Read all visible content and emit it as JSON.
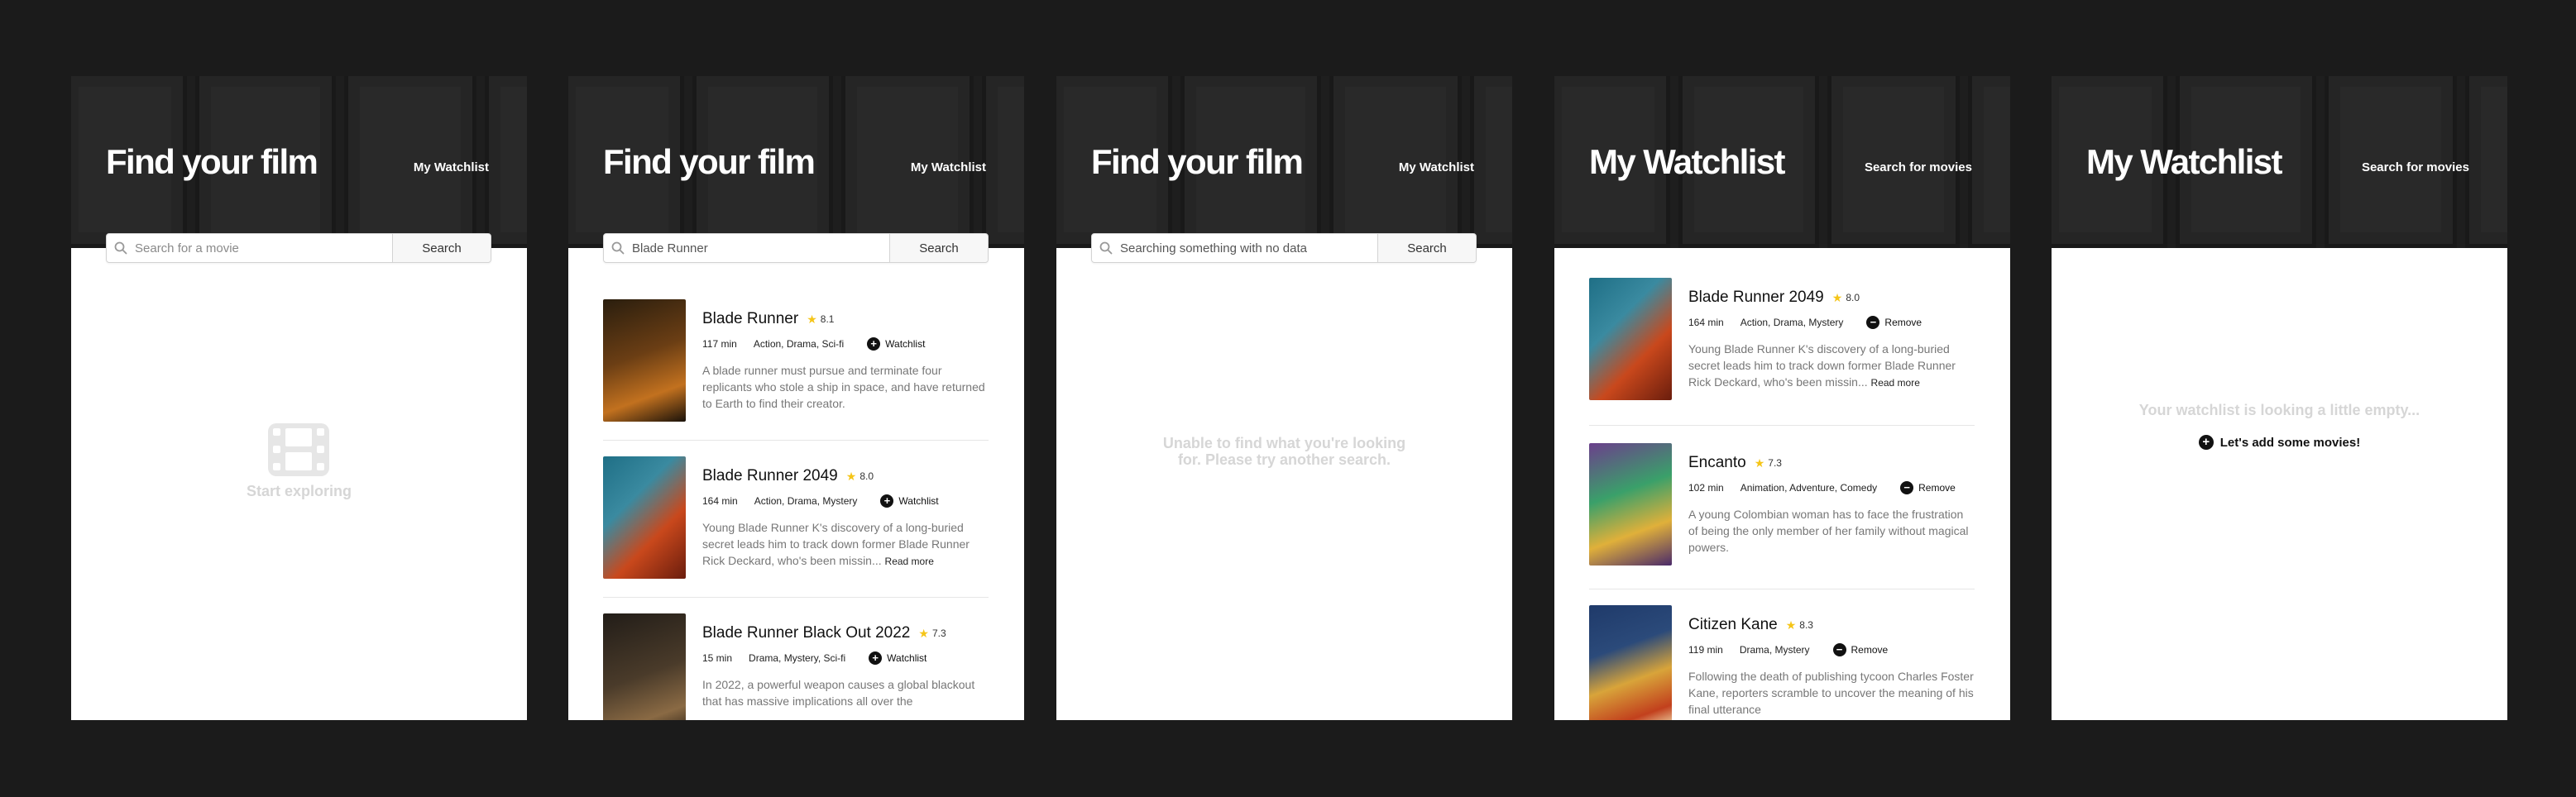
{
  "screens": [
    {
      "hero_title": "Find your film",
      "nav_link": "My Watchlist",
      "search": {
        "placeholder": "Search for a movie",
        "button": "Search"
      },
      "empty_text": "Start exploring",
      "empty_icon": "film-icon"
    },
    {
      "hero_title": "Find your film",
      "nav_link": "My Watchlist",
      "search": {
        "value": "Blade Runner",
        "button": "Search"
      },
      "results": [
        {
          "title": "Blade Runner",
          "rating": "8.1",
          "runtime": "117 min",
          "genres": "Action, Drama, Sci-fi",
          "action": "Watchlist",
          "description": "A blade runner must pursue and terminate four replicants who stole a ship in space, and have returned to Earth to find their creator.",
          "poster_colors": [
            "#3a2a12",
            "#b0611d"
          ]
        },
        {
          "title": "Blade Runner 2049",
          "rating": "8.0",
          "runtime": "164 min",
          "genres": "Action, Drama, Mystery",
          "action": "Watchlist",
          "description": "Young Blade Runner K's discovery of a long-buried secret leads him to track down former Blade Runner Rick Deckard, who's been missin...",
          "read_more": "Read more",
          "poster_colors": [
            "#1f6f86",
            "#d44a1d"
          ]
        },
        {
          "title": "Blade Runner Black Out 2022",
          "rating": "7.3",
          "runtime": "15 min",
          "genres": "Drama, Mystery, Sci-fi",
          "action": "Watchlist",
          "description": "In 2022, a powerful weapon causes a global blackout that has massive implications all over the",
          "poster_colors": [
            "#2a241d",
            "#7a5a3a"
          ]
        }
      ]
    },
    {
      "hero_title": "Find your film",
      "nav_link": "My Watchlist",
      "search": {
        "value": "Searching something with no data",
        "button": "Search"
      },
      "empty_text": "Unable to find what you're looking for. Please try another search."
    },
    {
      "hero_title": "My Watchlist",
      "nav_link": "Search for movies",
      "items": [
        {
          "title": "Blade Runner 2049",
          "rating": "8.0",
          "runtime": "164 min",
          "genres": "Action, Drama, Mystery",
          "action": "Remove",
          "description": "Young Blade Runner K's discovery of a long-buried secret leads him to track down former Blade Runner Rick Deckard, who's been missin...",
          "read_more": "Read more",
          "poster_colors": [
            "#1f6f86",
            "#d44a1d"
          ]
        },
        {
          "title": "Encanto",
          "rating": "7.3",
          "runtime": "102 min",
          "genres": "Animation, Adventure, Comedy",
          "action": "Remove",
          "description": "A young Colombian woman has to face the frustration of being the only member of her family without magical powers.",
          "poster_colors": [
            "#5a3a7a",
            "#3aa06a"
          ]
        },
        {
          "title": "Citizen Kane",
          "rating": "8.3",
          "runtime": "119 min",
          "genres": "Drama, Mystery",
          "action": "Remove",
          "description": "Following the death of publishing tycoon Charles Foster Kane, reporters scramble to uncover the meaning of his final utterance",
          "poster_colors": [
            "#2b4a7a",
            "#d8a43a"
          ]
        }
      ]
    },
    {
      "hero_title": "My Watchlist",
      "nav_link": "Search for movies",
      "empty_text": "Your watchlist is looking a little empty...",
      "add_link": "Let's add some movies!"
    }
  ],
  "colors": {
    "background": "#1b1b1b",
    "star": "#f5c518",
    "empty_text": "#d6d6d6",
    "muted_text": "#777777"
  }
}
